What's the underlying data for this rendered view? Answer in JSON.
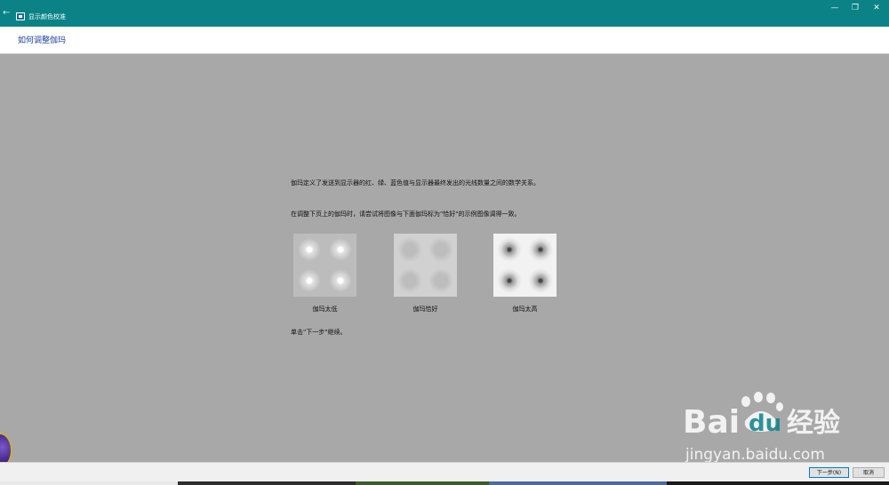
{
  "window": {
    "title": "显示颜色校准",
    "icons": {
      "back": "back-arrow-icon",
      "app": "display-calibration-icon"
    },
    "controls": {
      "minimize": "—",
      "restore": "❐",
      "close": "✕"
    }
  },
  "page": {
    "title": "如何调整伽玛"
  },
  "content": {
    "paragraph1": "伽玛定义了发送到显示器的红、绿、蓝色值与显示器最终发出的光线数量之间的数学关系。",
    "paragraph2": "在调整下页上的伽玛时，请尝试将图像与下面伽玛标为\"恰好\"的示例图像调得一致。",
    "samples": [
      {
        "caption": "伽玛太低"
      },
      {
        "caption": "伽玛恰好"
      },
      {
        "caption": "伽玛太高"
      }
    ],
    "instruction": "单击\"下一步\"继续。"
  },
  "footer": {
    "next_label": "下一步(N)",
    "cancel_label": "取消"
  },
  "watermark": {
    "brand": "Bai",
    "brand2": "du",
    "cn": "经验",
    "url": "jingyan.baidu.com"
  },
  "colors": {
    "titlebar": "#0a8286",
    "page_title": "#1e3f9e",
    "background": "#a8a8a8"
  }
}
